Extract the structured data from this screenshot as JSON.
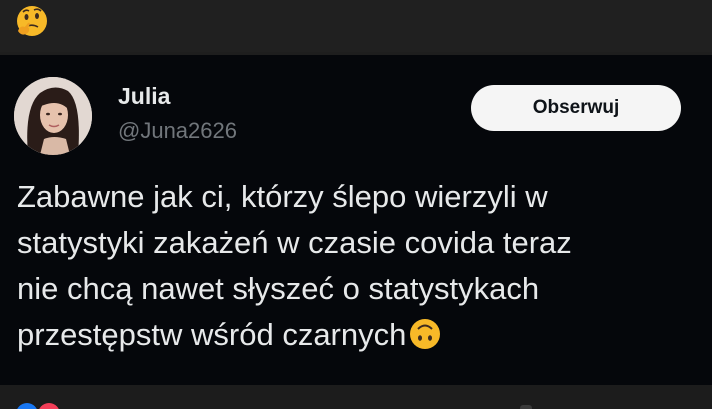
{
  "header": {
    "emoji_icon": "thinking-face-icon"
  },
  "tweet": {
    "author": {
      "name": "Julia",
      "handle": "@Juna2626",
      "avatar_icon": "user-avatar"
    },
    "follow_label": "Obserwuj",
    "text_lines": [
      "Zabawne jak ci, którzy ślepo wierzyli w",
      "statystyki zakażeń w czasie covida teraz",
      "nie chcą nawet słyszeć o statystykach",
      "przestępstw wśród czarnych"
    ],
    "trailing_emoji": "upside-down-face-icon"
  },
  "footer": {
    "reaction_icons": [
      "like-reaction-icon",
      "love-reaction-icon"
    ]
  },
  "colors": {
    "card_background": "#05070b",
    "text_primary": "#e7e9ea",
    "text_secondary": "#71767b",
    "button_background": "#f5f5f5",
    "emoji_yellow": "#f7b928"
  }
}
